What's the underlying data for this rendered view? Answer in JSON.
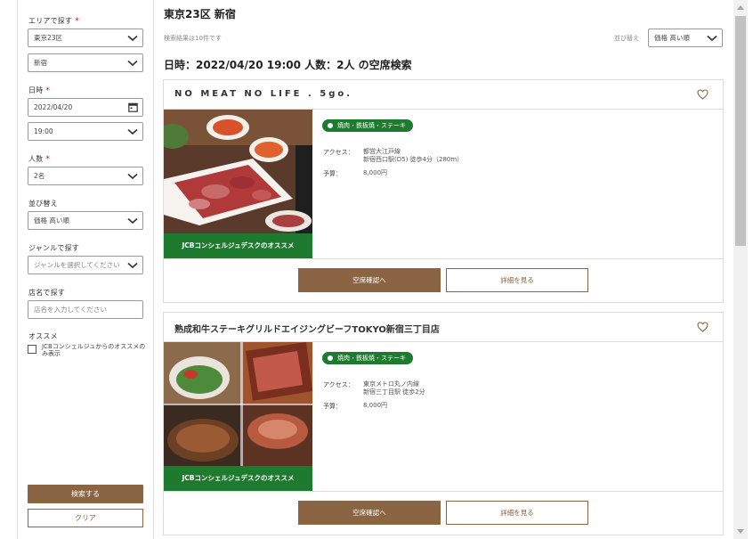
{
  "sidebar": {
    "area_label": "エリアで探す",
    "area_value": "東京23区",
    "subarea_value": "新宿",
    "date_label": "日時",
    "date_value": "2022/04/20",
    "time_value": "19:00",
    "people_label": "人数",
    "people_value": "2名",
    "sort_label": "並び替え",
    "sort_value": "価格 高い順",
    "genre_label": "ジャンルで探す",
    "genre_placeholder": "ジャンルを選択してください",
    "name_label": "店名で探す",
    "name_placeholder": "店名を入力してください",
    "recommend_label": "オススメ",
    "recommend_checkbox_label": "JCBコンシェルジュからのオススメのみ表示",
    "required_mark": "*",
    "search_button": "検索する",
    "clear_button": "クリア"
  },
  "main": {
    "title": "東京23区 新宿",
    "result_count": "検索結果は10件です",
    "sort_label": "並び替え",
    "sort_value": "価格 高い順",
    "search_heading": "日時：2022/04/20 19:00 人数：2人 の空席検索"
  },
  "restaurants": [
    {
      "name": "NO MEAT NO LIFE . 5go.",
      "genre": "焼肉・鉄板焼・ステーキ",
      "recommend_band": "JCBコンシェルジュデスクのオススメ",
      "access_label": "アクセス：",
      "access_line1": "都営大江戸線",
      "access_line2": "新宿西口駅(D5) 徒歩4分（280m）",
      "budget_label": "予算：",
      "budget_value": "8,000円",
      "vacancy_button": "空席確認へ",
      "detail_button": "詳細を見る"
    },
    {
      "name": "熟成和牛ステーキグリルドエイジングビーフTOKYO新宿三丁目店",
      "genre": "焼肉・鉄板焼・ステーキ",
      "recommend_band": "JCBコンシェルジュデスクのオススメ",
      "access_label": "アクセス：",
      "access_line1": "東京メトロ丸ノ内線",
      "access_line2": "新宿三丁目駅 徒歩2分",
      "budget_label": "予算：",
      "budget_value": "8,000円",
      "vacancy_button": "空席確認へ",
      "detail_button": "詳細を見る"
    }
  ],
  "colors": {
    "brand_brown": "#8a6443",
    "recommend_green": "#1e7a2e",
    "required_red": "#b3152a"
  },
  "icons": [
    "chevron-down-icon",
    "calendar-icon",
    "heart-icon",
    "scroll-up-arrow-icon",
    "scroll-down-arrow-icon"
  ]
}
